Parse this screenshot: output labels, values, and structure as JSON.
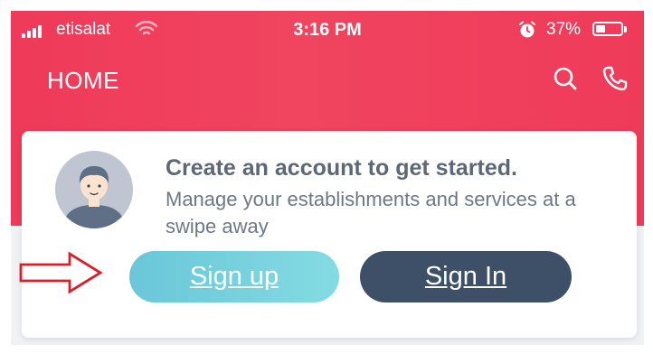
{
  "status_bar": {
    "carrier": "etisalat",
    "time": "3:16 PM",
    "battery_percent": "37%",
    "battery_level": 0.37
  },
  "nav": {
    "title": "HOME",
    "icons": [
      "search-icon",
      "phone-icon"
    ]
  },
  "card": {
    "heading": "Create an account to get started.",
    "subtext": "Manage your establishments and services at a swipe away",
    "signup_label": "Sign up",
    "signin_label": "Sign In"
  },
  "colors": {
    "header": "#ef3a5a",
    "signup_button": "#69c7d8",
    "signin_button": "#3d5068",
    "annotation_arrow": "#d9202a"
  }
}
